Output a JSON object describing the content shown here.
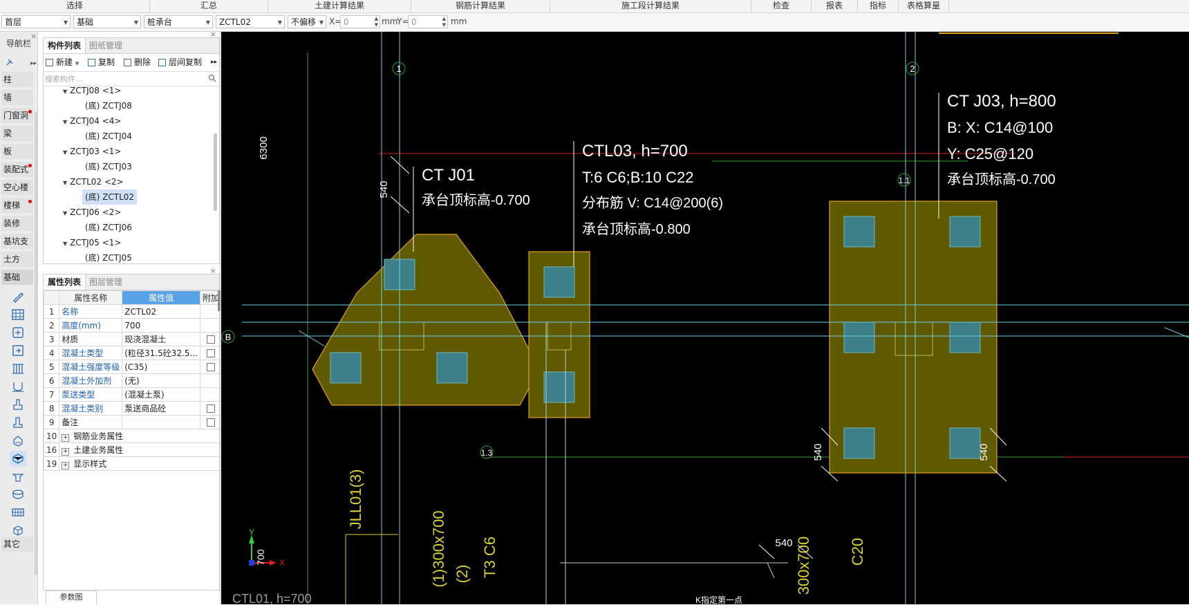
{
  "ribbon": {
    "groups": [
      "选择",
      "汇总",
      "土建计算结果",
      "钢筋计算结果",
      "施工段计算结果",
      "检查",
      "报表",
      "指标",
      "表格算量"
    ]
  },
  "toolbar": {
    "floor": "首层",
    "category": "基础",
    "type": "桩承台",
    "component": "ZCTL02",
    "offset": "不偏移",
    "x_label": "X=",
    "x_value": "0",
    "unit1": "mm",
    "y_label": "Y=",
    "y_value": "0",
    "unit2": "mm"
  },
  "nav": {
    "title": "导航栏",
    "items": [
      "柱",
      "墙",
      "门窗洞",
      "梁",
      "板",
      "装配式",
      "空心楼盖",
      "楼梯",
      "装修",
      "基坑支护",
      "土方",
      "基础"
    ],
    "bottom": "其它"
  },
  "component_panel": {
    "tabs": [
      "构件列表",
      "图纸管理"
    ],
    "buttons": [
      "新建",
      "复制",
      "删除",
      "层间复制"
    ],
    "search_placeholder": "搜索构件...",
    "tree": [
      {
        "group": "ZCTJ08 <1>",
        "child": "(底) ZCTJ08"
      },
      {
        "group": "ZCTJ04 <4>",
        "child": "(底) ZCTJ04"
      },
      {
        "group": "ZCTJ03 <1>",
        "child": "(底) ZCTJ03"
      },
      {
        "group": "ZCTL02 <2>",
        "child": "(底) ZCTL02"
      },
      {
        "group": "ZCTJ06 <2>",
        "child": "(底) ZCTJ06"
      },
      {
        "group": "ZCTJ05 <1>",
        "child": "(底) ZCTJ05"
      }
    ]
  },
  "property_panel": {
    "tabs": [
      "属性列表",
      "图层管理"
    ],
    "headers": [
      "属性名称",
      "属性值",
      "附加"
    ],
    "rows": [
      {
        "n": "1",
        "name": "名称",
        "value": "ZCTL02"
      },
      {
        "n": "2",
        "name": "高度(mm)",
        "value": "700"
      },
      {
        "n": "3",
        "name": "材质",
        "value": "现浇混凝土"
      },
      {
        "n": "4",
        "name": "混凝土类型",
        "value": "(粒径31.5砼32.5..."
      },
      {
        "n": "5",
        "name": "混凝土强度等级",
        "value": "(C35)"
      },
      {
        "n": "6",
        "name": "混凝土外加剂",
        "value": "(无)"
      },
      {
        "n": "7",
        "name": "泵送类型",
        "value": "(混凝土泵)"
      },
      {
        "n": "8",
        "name": "混凝土类别",
        "value": "泵送商品砼"
      },
      {
        "n": "9",
        "name": "备注",
        "value": ""
      },
      {
        "n": "10",
        "name": "钢筋业务属性",
        "value": ""
      },
      {
        "n": "16",
        "name": "土建业务属性",
        "value": ""
      },
      {
        "n": "19",
        "name": "显示样式",
        "value": ""
      }
    ],
    "bottom_tab": "参数图"
  },
  "cad": {
    "axis_labels": [
      "1",
      "2",
      "B",
      "1.1",
      "1.3"
    ],
    "dim_6300": "6300",
    "label1_line1": "CT J01",
    "label1_line2": "承台顶标高-0.700",
    "label2_line1": "CTL03, h=700",
    "label2_line2": "T:6 C6;B:10 C22",
    "label2_line3": "分布筋 V: C14@200(6)",
    "label2_line4": "承台顶标高-0.800",
    "label3_line1": "CT J03, h=800",
    "label3_line2": "B: X: C14@100",
    "label3_line3": "Y: C25@120",
    "label3_line4": "承台顶标高-0.700",
    "dim_540": "540",
    "beam_label": "JLL01(3)",
    "beam2": "(1)300x700",
    "beam3": "T3 C6",
    "beam4": "(2)",
    "beam5": "300x700",
    "beam6": "C20",
    "dim_700": "700",
    "axis_x": "X",
    "axis_y": "Y",
    "bottom_label": "CTL01, h=700",
    "bottom_right": "K指定第一点"
  },
  "colors": {
    "cap_fill": "#5f5a00",
    "cap_stroke": "#e0a020",
    "pile": "#3c7f86",
    "axis_cyan": "#6fd2e6",
    "axis_green": "#3aaa3a"
  }
}
